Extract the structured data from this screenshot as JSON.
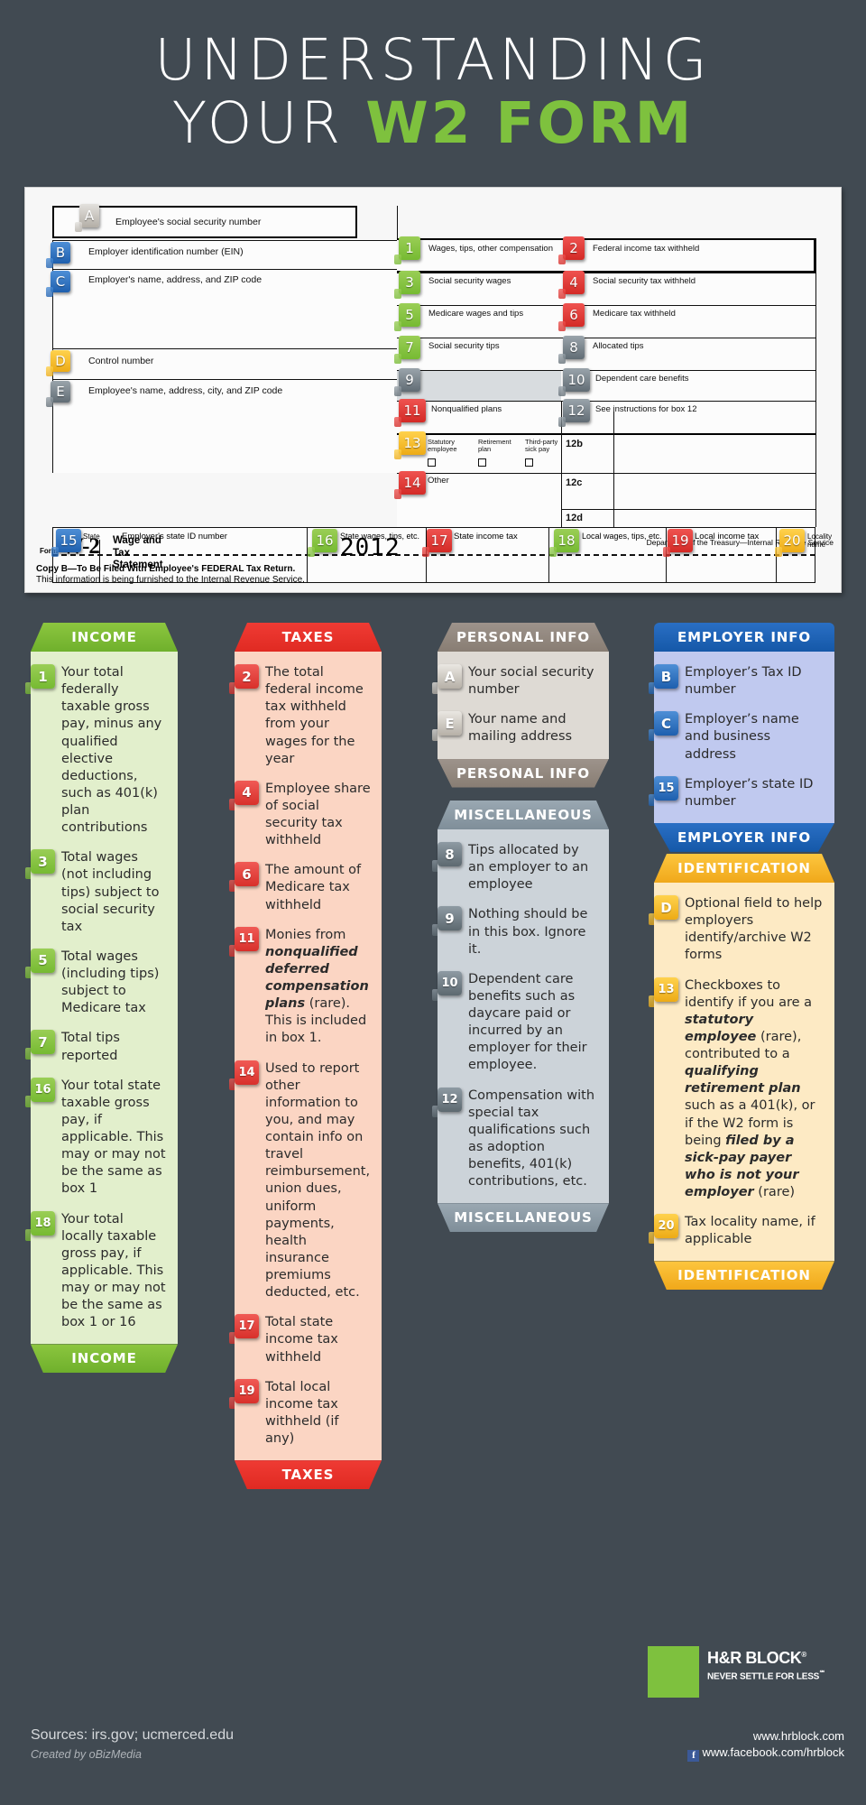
{
  "header": {
    "line1": "UNDERSTANDING",
    "line2_plain": "YOUR ",
    "line2_hl": "W2 FORM"
  },
  "w2form": {
    "a_label": "Employee's social security number",
    "b_label": "Employer identification number (EIN)",
    "c_label": "Employer's name, address, and ZIP code",
    "d_label": "Control number",
    "e_label": "Employee's name, address, city, and ZIP code",
    "box1": "Wages, tips, other compensation",
    "box2": "Federal income tax withheld",
    "box3": "Social security wages",
    "box4": "Social security tax withheld",
    "box5": "Medicare wages and tips",
    "box6": "Medicare tax withheld",
    "box7": "Social security tips",
    "box8": "Allocated tips",
    "box9": "",
    "box10": "Dependent care benefits",
    "box11": "Nonqualified plans",
    "box12": "See instructions for box 12",
    "box12b": "12b",
    "box12c": "12c",
    "box12d": "12d",
    "cb1": "Statutory employee",
    "cb2": "Retirement plan",
    "cb3": "Third-party sick pay",
    "box14": "Other",
    "box15": "State",
    "box15b": "Employer's state ID number",
    "box16": "State wages, tips, etc.",
    "box17": "State income tax",
    "box18": "Local wages, tips, etc.",
    "box19": "Local income tax",
    "box20": "Locality name",
    "form_word": "Form",
    "form_no": "W-2",
    "form_title": "Wage and Tax Statement",
    "year": "2012",
    "treasury": "Department of the Treasury—Internal Revenue Service",
    "copy_b": "Copy B—To Be Filed With Employee's FEDERAL Tax Return.",
    "furnished": "This information is being furnished to the Internal Revenue Service.",
    "tags": {
      "a": "A",
      "b": "B",
      "c": "C",
      "d": "D",
      "e": "E",
      "n1": "1",
      "n2": "2",
      "n3": "3",
      "n4": "4",
      "n5": "5",
      "n6": "6",
      "n7": "7",
      "n8": "8",
      "n9": "9",
      "n10": "10",
      "n11": "11",
      "n12": "12",
      "n13": "13",
      "n14": "14",
      "n15": "15",
      "n16": "16",
      "n17": "17",
      "n18": "18",
      "n19": "19",
      "n20": "20"
    }
  },
  "columns": {
    "income": {
      "title": "INCOME",
      "accent": "#8cc63f",
      "items": [
        {
          "n": "1",
          "text": "Your total federally taxable gross pay, minus any qualified elective deductions, such as 401(k) plan contributions"
        },
        {
          "n": "3",
          "text": "Total wages (not including tips) subject to social security tax"
        },
        {
          "n": "5",
          "text": "Total wages (including tips) subject to Medicare tax"
        },
        {
          "n": "7",
          "text": "Total tips reported"
        },
        {
          "n": "16",
          "text": "Your total state taxable gross pay, if applicable. This may or may not be the same as box 1"
        },
        {
          "n": "18",
          "text": "Your total locally taxable gross pay, if applicable. This may or may not be the same as box 1 or 16"
        }
      ]
    },
    "taxes": {
      "title": "TAXES",
      "accent": "#ef3b34",
      "items": [
        {
          "n": "2",
          "text": "The total federal income tax withheld from your wages for the year"
        },
        {
          "n": "4",
          "text": "Employee share of social security tax withheld"
        },
        {
          "n": "6",
          "text": "The amount of Medicare tax withheld"
        },
        {
          "n": "11",
          "text": "Monies from |nonqualified deferred compensation plans| (rare). This is included in box 1."
        },
        {
          "n": "14",
          "text": "Used to report other information to you, and may contain info on travel reimbursement, union dues, uniform payments, health insurance premiums deducted, etc."
        },
        {
          "n": "17",
          "text": "Total state income tax withheld"
        },
        {
          "n": "19",
          "text": "Total local income tax withheld (if any)"
        }
      ]
    },
    "personal": {
      "title": "PERSONAL INFO",
      "accent": "#9d938b",
      "items": [
        {
          "n": "A",
          "text": "Your social security number"
        },
        {
          "n": "E",
          "text": "Your name and mailing address"
        }
      ]
    },
    "misc": {
      "title": "MISCELLANEOUS",
      "accent": "#9aa8b2",
      "items": [
        {
          "n": "8",
          "text": "Tips allocated by an employer to an employee"
        },
        {
          "n": "9",
          "text": "Nothing should be in this box. Ignore it."
        },
        {
          "n": "10",
          "text": "Dependent care benefits such as daycare paid or incurred by an employer for their employee."
        },
        {
          "n": "12",
          "text": "Compensation with special tax qualifications such as adoption benefits, 401(k) contributions, etc."
        }
      ]
    },
    "employer": {
      "title": "EMPLOYER INFO",
      "accent": "#1558a8",
      "items": [
        {
          "n": "B",
          "text": "Employer’s Tax ID number"
        },
        {
          "n": "C",
          "text": "Employer’s name and business address"
        },
        {
          "n": "15",
          "text": "Employer’s state ID number"
        }
      ]
    },
    "ident": {
      "title": "IDENTIFICATION",
      "accent": "#fdc63f",
      "items": [
        {
          "n": "D",
          "text": "Optional field to help employers identify/archive W2 forms"
        },
        {
          "n": "13",
          "text": "Checkboxes to identify if you are a |statutory employee| (rare), contributed to a |qualifying retirement plan| such as a 401(k), or if the W2 form is being |filed by a sick-pay payer who is not your employer| (rare)"
        },
        {
          "n": "20",
          "text": "Tax locality name, if applicable"
        }
      ]
    }
  },
  "footer": {
    "brand_name": "H&R BLOCK",
    "brand_sup": "®",
    "brand_tagline": "NEVER SETTLE FOR LESS",
    "brand_tagline_sup": "℠",
    "sources": "Sources: irs.gov; ucmerced.edu",
    "created_by": "Created by oBizMedia",
    "url_site": "www.hrblock.com",
    "url_fb": "www.facebook.com/hrblock",
    "fb_glyph": "f"
  }
}
